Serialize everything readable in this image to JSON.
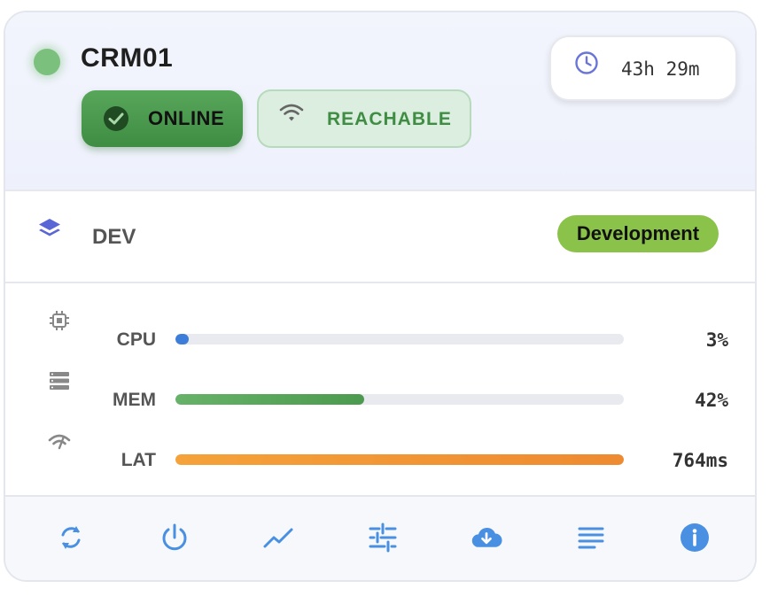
{
  "header": {
    "host_name": "CRM01",
    "status_label": "ONLINE",
    "reachability_label": "REACHABLE",
    "uptime": "43h 29m"
  },
  "environment": {
    "name": "DEV",
    "badge": "Development",
    "badge_color": "#8bc34a"
  },
  "metrics": [
    {
      "label": "CPU",
      "value_text": "3%",
      "percent": 3,
      "icon": "cpu-icon",
      "color": "#3b7dd8"
    },
    {
      "label": "MEM",
      "value_text": "42%",
      "percent": 42,
      "icon": "memory-icon",
      "color": "#4c9a4f"
    },
    {
      "label": "LAT",
      "value_text": "764ms",
      "percent": 100,
      "icon": "latency-icon",
      "color": "#ee8a30"
    }
  ],
  "actions": [
    {
      "name": "refresh-icon"
    },
    {
      "name": "power-icon"
    },
    {
      "name": "chart-icon"
    },
    {
      "name": "settings-sliders-icon"
    },
    {
      "name": "cloud-download-icon"
    },
    {
      "name": "logs-icon"
    },
    {
      "name": "info-icon"
    }
  ],
  "colors": {
    "online": "#4a9a4d",
    "reachable_text": "#3f8d43",
    "icon_blue": "#4a90e2",
    "accent_indigo": "#6a75d8"
  }
}
